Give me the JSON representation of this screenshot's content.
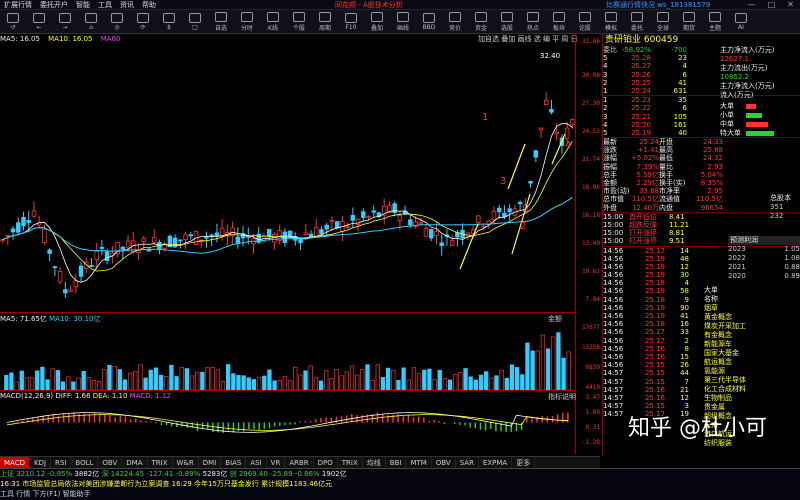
{
  "menubar": {
    "items": [
      "扩展行情",
      "委托开户",
      "智能",
      "工具",
      "资讯",
      "帮助"
    ],
    "brand": "同花顺 - A股技术分析",
    "user": "比赛通行情快况  ws_181381579",
    "controls": [
      "—",
      "□",
      "✕"
    ]
  },
  "toolbar": {
    "buttons": [
      "↺",
      "←",
      "→",
      "⌂",
      "◎",
      "⟳",
      "$",
      "□",
      "自选",
      "分时",
      "K线",
      "个股",
      "周期",
      "F10",
      "叠加",
      "画线",
      "BBD",
      "竞价",
      "资金",
      "选股",
      "热点",
      "板块",
      "论股",
      "模拟",
      "委托",
      "全球",
      "期货",
      "主题",
      "AI"
    ]
  },
  "chart_info": {
    "ma_label": "MA5: 16.05",
    "ma10_label": "MA10: 16.05",
    "ma_other": "MA60",
    "indicators": [
      "加自选",
      "叠加",
      "画线",
      "选",
      "编",
      "平",
      "周",
      "日"
    ]
  },
  "axis_prices": [
    "32.86",
    "30.08",
    "27.30",
    "24.52",
    "21.74",
    "18.96",
    "16.18",
    "13.40",
    "10.62",
    "7.84"
  ],
  "vol_axis": [
    "17677",
    "13258",
    "8839",
    "4419"
  ],
  "macd_axis": [
    "3.47",
    "1.89",
    "0.31",
    "-1.28"
  ],
  "vol_info": {
    "label": "MA5: 71.65亿",
    "ma10": "MA10: 30.10亿",
    "tag": "金额"
  },
  "macd_info": {
    "label": "MACD(12,26,9)",
    "diff": "DIFF: 1.66",
    "dea": "DEA: 1.10",
    "macd": "MACD: 1.12",
    "tag": "指标说明"
  },
  "chart_annotations": {
    "peak": "32.40",
    "marks": [
      "1",
      "2",
      "3",
      "4"
    ]
  },
  "tabs": [
    "MACD",
    "KDJ",
    "RSI",
    "BOLL",
    "OBV",
    "DMA",
    "TRIX",
    "W&R",
    "DMI",
    "BIAS",
    "ASI",
    "VR",
    "ARBR",
    "DPO",
    "TRIX",
    "均线",
    "BBI",
    "MTM",
    "OBV",
    "SAR",
    "EXPMA",
    "更多"
  ],
  "status": {
    "row1": [
      "上证 3210.12  -0.95%",
      "3882亿",
      "深 14224.45 -127.41 -0.89%",
      "5283亿",
      "创 2969.40 -25.89 -0.86%",
      "1902亿"
    ],
    "row2": "16:31 市场监管总局依法对美团涉嫌垄断行为立案调查   16:29 今年15万只基金发行 累计规模1183.46亿元",
    "row3": "工具 行情 下方(F1) 智能助手"
  },
  "quote": {
    "title": "贵研铂业 600459",
    "weibi": {
      "label": "委比",
      "value": "-58.92%",
      "diff": "-700"
    },
    "asks": [
      {
        "n": "5",
        "price": "25.28",
        "vol": "23"
      },
      {
        "n": "4",
        "price": "25.27",
        "vol": "4"
      },
      {
        "n": "3",
        "price": "25.26",
        "vol": "6"
      },
      {
        "n": "2",
        "price": "25.25",
        "vol": "41"
      },
      {
        "n": "1",
        "price": "25.24",
        "vol": "631"
      }
    ],
    "bids": [
      {
        "n": "1",
        "price": "25.23",
        "vol": "35"
      },
      {
        "n": "2",
        "price": "25.22",
        "vol": "6"
      },
      {
        "n": "3",
        "price": "25.21",
        "vol": "105"
      },
      {
        "n": "4",
        "price": "25.20",
        "vol": "161"
      },
      {
        "n": "5",
        "price": "25.19",
        "vol": "40"
      }
    ],
    "flow_labels": [
      "主力净流入(万元)",
      "12627.1",
      "主力流出(万元)",
      "10852.2",
      "主力净流入(万元)",
      "流入(万元)"
    ],
    "stats": [
      [
        "最新",
        "25.24",
        "开盘",
        "24.33"
      ],
      [
        "涨跌",
        "+1.41",
        "最高",
        "25.88"
      ],
      [
        "涨幅",
        "+5.92%",
        "最低",
        "24.32"
      ],
      [
        "振幅",
        "7.39%",
        "量比",
        "2.93"
      ],
      [
        "总手",
        "5.59亿",
        "换手",
        "5.04%"
      ],
      [
        "金额",
        "2.29亿",
        "换手(实)",
        "8.35%"
      ],
      [
        "市盈(动)",
        "33.88",
        "市净率",
        "2.95"
      ],
      [
        "总市值",
        "110.5亿",
        "流通值",
        "110.5亿"
      ],
      [
        "外盘",
        "12.40万",
        "内盘",
        "96654"
      ]
    ],
    "flow_block": [
      "大单",
      "小单",
      "中单",
      "特大单"
    ],
    "right_values": [
      "351",
      "232",
      "1.08",
      "1.05"
    ],
    "right_titles": [
      "总股本",
      "预测利润"
    ],
    "ticks": [
      {
        "t": "14:56",
        "p": "25.17",
        "v": "14"
      },
      {
        "t": "14:56",
        "p": "25.19",
        "v": "48"
      },
      {
        "t": "14:56",
        "p": "25.19",
        "v": "12"
      },
      {
        "t": "14:56",
        "p": "25.19",
        "v": "30"
      },
      {
        "t": "14:56",
        "p": "25.18",
        "v": "4"
      },
      {
        "t": "14:56",
        "p": "25.19",
        "v": "58"
      },
      {
        "t": "14:56",
        "p": "25.18",
        "v": "9"
      },
      {
        "t": "14:56",
        "p": "25.19",
        "v": "90"
      },
      {
        "t": "14:56",
        "p": "25.19",
        "v": "41"
      },
      {
        "t": "14:56",
        "p": "25.18",
        "v": "16"
      },
      {
        "t": "14:56",
        "p": "25.17",
        "v": "33"
      },
      {
        "t": "14:56",
        "p": "25.17",
        "v": "2"
      },
      {
        "t": "14:56",
        "p": "25.16",
        "v": "8"
      },
      {
        "t": "14:56",
        "p": "25.16",
        "v": "15"
      },
      {
        "t": "14:56",
        "p": "25.15",
        "v": "26"
      },
      {
        "t": "14:57",
        "p": "25.15",
        "v": "44"
      },
      {
        "t": "14:57",
        "p": "25.15",
        "v": "7"
      },
      {
        "t": "14:57",
        "p": "25.16",
        "v": "21"
      },
      {
        "t": "14:57",
        "p": "25.16",
        "v": "12"
      },
      {
        "t": "14:57",
        "p": "25.15",
        "v": "3"
      },
      {
        "t": "14:57",
        "p": "25.17",
        "v": "19"
      }
    ],
    "concepts": [
      "大单",
      "名称",
      "烟草",
      "黄金概念",
      "煤炭开采加工",
      "有金概念",
      "新能源车",
      "国家大基金",
      "航运概念",
      "氢能源",
      "第三代半导体",
      "化工合成材料",
      "生物制品",
      "贵金属",
      "超级概念",
      "云南",
      "港口航运",
      "纺织服装"
    ],
    "events": [
      {
        "t": "15:00",
        "tag": "首开低位",
        "n": "8.41"
      },
      {
        "t": "15:00",
        "tag": "超跌反弹",
        "n": "11.21"
      },
      {
        "t": "15:00",
        "tag": "打开涨停",
        "n": "8.81"
      },
      {
        "t": "15:00",
        "tag": "打开涨停",
        "n": "9.51"
      }
    ],
    "years": [
      [
        "2023",
        "1.05"
      ],
      [
        "2022",
        "1.08"
      ],
      [
        "2021",
        "0.88"
      ],
      [
        "2020",
        "0.89"
      ]
    ],
    "watermark": "知乎 @杜小可"
  },
  "colors": {
    "up": "#ff3333",
    "down": "#33ccff",
    "ma1": "#ffffff",
    "ma2": "#ffff33",
    "ma3": "#ff33ff",
    "ma4": "#33ffcc",
    "axis": "#990000"
  }
}
